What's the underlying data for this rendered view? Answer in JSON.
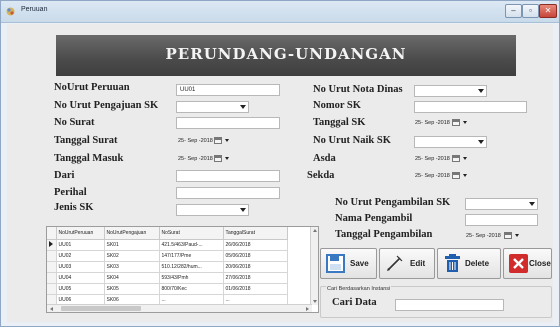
{
  "window": {
    "title": "Peruuan"
  },
  "banner": {
    "title": "PERUNDANG-UNDANGAN"
  },
  "left_form": {
    "no_urut_peruuan": {
      "label": "NoUrut Peruuan",
      "value": "UU01"
    },
    "no_urut_pengajuan_sk": {
      "label": "No Urut Pengajuan SK",
      "value": ""
    },
    "no_surat": {
      "label": "No Surat",
      "value": ""
    },
    "tanggal_surat": {
      "label": "Tanggal Surat",
      "value": "25- Sep -2018"
    },
    "tanggal_masuk": {
      "label": "Tanggal Masuk",
      "value": "25- Sep -2018"
    },
    "dari": {
      "label": "Dari",
      "value": ""
    },
    "perihal": {
      "label": "Perihal",
      "value": ""
    },
    "jenis_sk": {
      "label": "Jenis SK",
      "value": ""
    }
  },
  "right_form": {
    "no_urut_nota_dinas": {
      "label": "No Urut Nota Dinas",
      "value": ""
    },
    "nomor_sk": {
      "label": "Nomor SK",
      "value": ""
    },
    "tanggal_sk": {
      "label": "Tanggal SK",
      "value": "25- Sep -2018"
    },
    "no_urut_naik_sk": {
      "label": "No Urut Naik SK",
      "value": ""
    },
    "asda": {
      "label": "Asda",
      "value": "25- Sep -2018"
    },
    "sekda": {
      "label": "Sekda",
      "value": "25- Sep -2018"
    }
  },
  "pengambilan": {
    "no_urut_pengambilan_sk": {
      "label": "No Urut Pengambilan SK",
      "value": ""
    },
    "nama_pengambil": {
      "label": "Nama Pengambil",
      "value": ""
    },
    "tanggal_pengambilan": {
      "label": "Tanggal Pengambilan",
      "value": "25- Sep -2018"
    }
  },
  "grid": {
    "columns": [
      "NoUrutPeruuan",
      "NoUrutPengajuan",
      "NoSurat",
      "TanggalSurat"
    ],
    "rows": [
      [
        "UU01",
        "SK01",
        "421.5/463/Paud-...",
        "26/06/2018"
      ],
      [
        "UU02",
        "SK02",
        "147/177/Pme",
        "05/06/2018"
      ],
      [
        "UU03",
        "SK03",
        "510.12/282/hum...",
        "20/06/2018"
      ],
      [
        "UU04",
        "SK04",
        "593/43/Pmh",
        "27/06/2018"
      ],
      [
        "UU05",
        "SK05",
        "800/70/Kec",
        "01/06/2018"
      ],
      [
        "UU06",
        "SK06",
        "...",
        "..."
      ]
    ]
  },
  "buttons": {
    "save": "Save",
    "edit": "Edit",
    "delete": "Delete",
    "close": "Close"
  },
  "search": {
    "group_title": "Cari Berdasarkan Instansi",
    "label": "Cari Data",
    "value": ""
  },
  "colors": {
    "banner_bg": "#4b4b4b",
    "save_icon": "#3a78c2",
    "delete_icon": "#1f5fae",
    "close_icon": "#d12b2b"
  }
}
